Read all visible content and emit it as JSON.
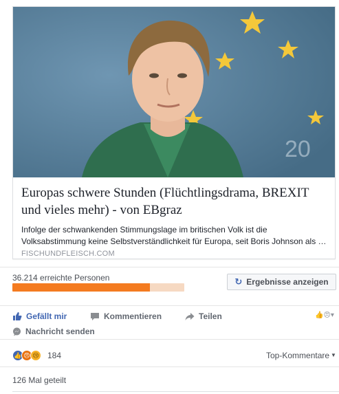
{
  "link_card": {
    "title": "Europas schwere Stunden (Flüchtlingsdrama, BREXIT und vieles mehr) - von EBgraz",
    "description": "Infolge der schwankenden Stimmungslage im britischen Volk ist die Volksabstimmung keine Selbstverständlichkeit für Europa, seit Boris Johnson als …",
    "domain": "FISCHUNDFLEISCH.COM"
  },
  "reach": {
    "text": "36.214 erreichte Personen",
    "progress": 0.8,
    "results_button_label": "Ergebnisse anzeigen",
    "results_icon": "refresh-icon"
  },
  "actions": {
    "like": "Gefällt mir",
    "comment": "Kommentieren",
    "share": "Teilen",
    "message": "Nachricht senden"
  },
  "reactions": {
    "types": [
      "like",
      "angry",
      "sad"
    ],
    "count": "184",
    "sort_label": "Top-Kommentare"
  },
  "shares": {
    "text": "126 Mal geteilt"
  },
  "colors": {
    "accent": "#4267b2",
    "progress": "#f47b20",
    "muted": "#90949c"
  }
}
